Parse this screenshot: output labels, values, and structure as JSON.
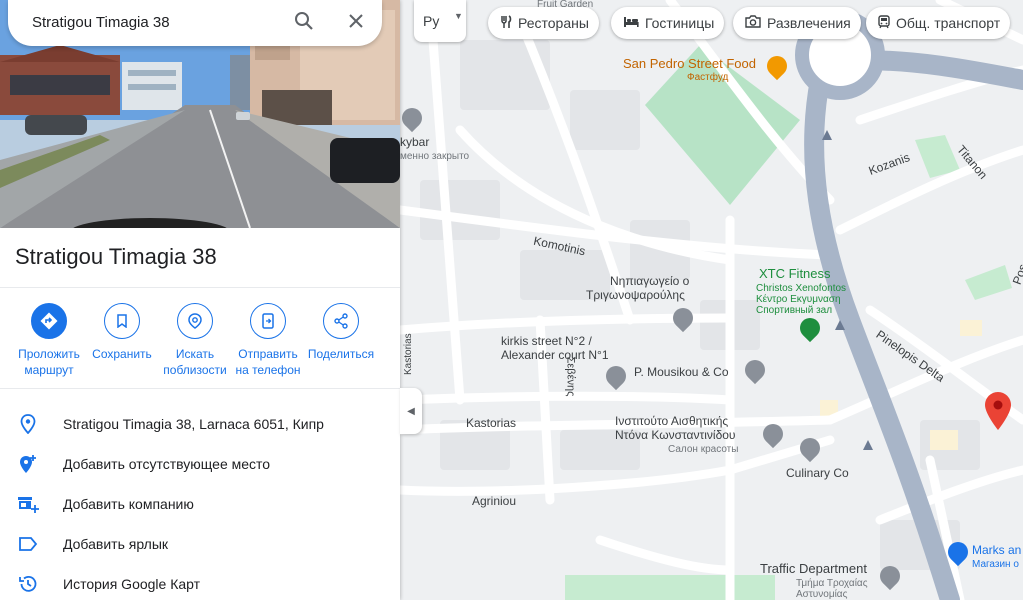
{
  "search": {
    "query": "Stratigou Timagia 38"
  },
  "place": {
    "title": "Stratigou Timagia 38"
  },
  "actions": [
    {
      "label": "Проложить маршрут",
      "icon": "directions-icon"
    },
    {
      "label": "Сохранить",
      "icon": "bookmark-icon"
    },
    {
      "label": "Искать поблизости",
      "icon": "nearby-icon"
    },
    {
      "label": "Отправить на телефон",
      "icon": "send-to-phone-icon"
    },
    {
      "label": "Поделиться",
      "icon": "share-icon"
    }
  ],
  "info_rows": [
    {
      "text": "Stratigou Timagia 38, Larnaca 6051, Кипр",
      "icon": "location-pin-icon"
    },
    {
      "text": "Добавить отсутствующее место",
      "icon": "add-place-icon"
    },
    {
      "text": "Добавить компанию",
      "icon": "add-business-icon"
    },
    {
      "text": "Добавить ярлык",
      "icon": "label-icon"
    },
    {
      "text": "История Google Карт",
      "icon": "history-icon"
    }
  ],
  "layer_button": {
    "label": "Ру"
  },
  "chips": [
    {
      "label": "Рестораны",
      "icon": "restaurant-icon"
    },
    {
      "label": "Гостиницы",
      "icon": "hotel-icon"
    },
    {
      "label": "Развлечения",
      "icon": "camera-icon"
    },
    {
      "label": "Общ. транспорт",
      "icon": "transit-icon"
    }
  ],
  "map": {
    "labels": {
      "fruit_garden": "Fruit Garden",
      "san_pedro": "San Pedro Street Food",
      "fastfood": "Фастфуд",
      "kybar": "kybar",
      "temp_closed": "менно закрыто",
      "kozanis": "Kozanis",
      "titanon": "Titanon",
      "komotinis": "Komotinis",
      "kindergarten_1": "Νηπιαγωγείο ο",
      "kindergarten_2": "Τριγωνοψαρούλης",
      "xtc": "XTC Fitness",
      "xtc_sub1": "Christos Xenofontos",
      "xtc_sub2": "Κέντρο Εκγυμναση",
      "xtc_sub3": "Спортивный зал",
      "kirkis_1": "kirkis street N°2 /",
      "kirkis_2": "Alexander court N°1",
      "mousikou": "P. Mousikou & Co",
      "pinelopis": "Pinelopis Delta",
      "kastorias_v": "Kastorias",
      "kastorias": "Kastorias",
      "sevenis": "Σεβένης",
      "institute_1": "Ινστιτούτο Αισθητικής",
      "institute_2": "Ντόνα Κωνσταντινίδου",
      "institute_3": "Салон красоты",
      "culinary": "Culinary Co",
      "agriniou": "Agriniou",
      "traffic_1": "Traffic Department",
      "traffic_2": "Τμήμα Τροχαίας",
      "traffic_3": "Αστυνομίας",
      "marks_1": "Marks an",
      "marks_2": "Магазин о",
      "pos": "Pos"
    },
    "colors": {
      "park": "#b7e3c6",
      "road_major": "#a8b5c8",
      "pin_red": "#ea4335"
    }
  }
}
